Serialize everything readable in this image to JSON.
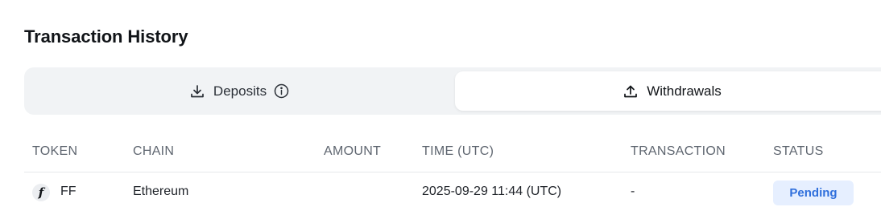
{
  "page": {
    "title": "Transaction History"
  },
  "tabs": [
    {
      "label": "Deposits",
      "icon": "download-icon",
      "has_info": true,
      "active": false
    },
    {
      "label": "Withdrawals",
      "icon": "upload-icon",
      "has_info": false,
      "active": true
    }
  ],
  "table": {
    "columns": [
      "TOKEN",
      "CHAIN",
      "AMOUNT",
      "TIME (UTC)",
      "TRANSACTION",
      "STATUS"
    ],
    "rows": [
      {
        "token_symbol": "FF",
        "token_icon_glyph": "f",
        "chain": "Ethereum",
        "amount": "",
        "time": "2025-09-29 11:44 (UTC)",
        "transaction": "-",
        "status": "Pending"
      }
    ]
  },
  "colors": {
    "status_pending_bg": "#e6efff",
    "status_pending_text": "#2f6fdc",
    "tab_bar_bg": "#f1f3f5"
  }
}
